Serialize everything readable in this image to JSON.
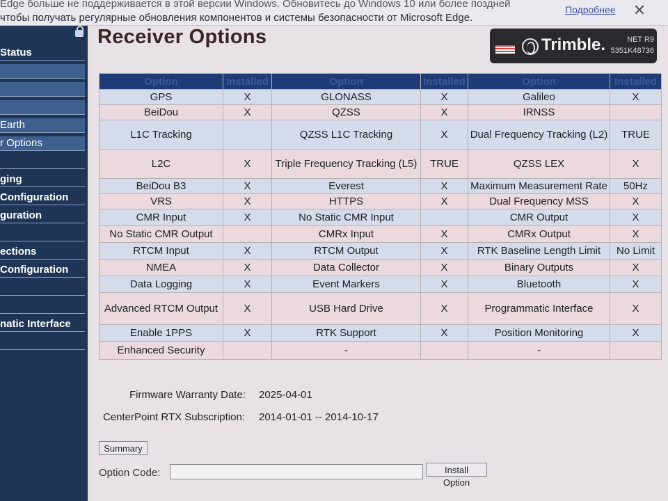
{
  "notification": {
    "line1": "Edge больше не поддерживается в этой версии Windows. Обновитесь до Windows 10 или более поздней",
    "line2": "чтобы получать регулярные обновления компонентов и системы безопасности от Microsoft Edge.",
    "link": "Подробнее",
    "close": "✕"
  },
  "sidebar": {
    "items": [
      {
        "label": "Status",
        "style": "dark"
      },
      {
        "label": "",
        "style": "light"
      },
      {
        "label": "",
        "style": "light"
      },
      {
        "label": "",
        "style": "light"
      },
      {
        "label": "Earth",
        "style": "light"
      },
      {
        "label": "r Options",
        "style": "light"
      },
      {
        "label": "",
        "style": "dark"
      },
      {
        "label": "ging",
        "style": "dark"
      },
      {
        "label": " Configuration",
        "style": "dark"
      },
      {
        "label": "guration",
        "style": "dark"
      },
      {
        "label": "",
        "style": "dark"
      },
      {
        "label": "ections",
        "style": "dark"
      },
      {
        "label": "Configuration",
        "style": "dark"
      },
      {
        "label": "",
        "style": "dark"
      },
      {
        "label": "",
        "style": "dark"
      },
      {
        "label": "natic Interface",
        "style": "dark"
      },
      {
        "label": "",
        "style": "dark"
      }
    ]
  },
  "header": {
    "title": "Receiver Options",
    "brand_name": "Trimble.",
    "model": "NET R9",
    "serial": "5351K48736"
  },
  "options_table": {
    "headers": [
      "Option",
      "Installed",
      "Option",
      "Installed",
      "Option",
      "Installed"
    ],
    "rows": [
      [
        "GPS",
        "X",
        "GLONASS",
        "X",
        "Galileo",
        "X"
      ],
      [
        "BeiDou",
        "X",
        "QZSS",
        "X",
        "IRNSS",
        ""
      ],
      [
        "L1C Tracking",
        "",
        "QZSS L1C Tracking",
        "X",
        "Dual Frequency Tracking (L2)",
        "TRUE"
      ],
      [
        "L2C",
        "X",
        "Triple Frequency Tracking (L5)",
        "TRUE",
        "QZSS LEX",
        "X"
      ],
      [
        "BeiDou B3",
        "X",
        "Everest",
        "X",
        "Maximum Measurement Rate",
        "50Hz"
      ],
      [
        "VRS",
        "X",
        "HTTPS",
        "X",
        "Dual Frequency MSS",
        "X"
      ],
      [
        "CMR Input",
        "X",
        "No Static CMR Input",
        "",
        "CMR Output",
        "X"
      ],
      [
        "No Static CMR Output",
        "",
        "CMRx Input",
        "X",
        "CMRx Output",
        "X"
      ],
      [
        "RTCM Input",
        "X",
        "RTCM Output",
        "X",
        "RTK Baseline Length Limit",
        "No Limit"
      ],
      [
        "NMEA",
        "X",
        "Data Collector",
        "X",
        "Binary Outputs",
        "X"
      ],
      [
        "Data Logging",
        "X",
        "Event Markers",
        "X",
        "Bluetooth",
        "X"
      ],
      [
        "Advanced RTCM Output",
        "X",
        "USB Hard Drive",
        "X",
        "Programmatic Interface",
        "X"
      ],
      [
        "Enable 1PPS",
        "X",
        "RTK Support",
        "X",
        "Position Monitoring",
        "X"
      ],
      [
        "Enhanced Security",
        "",
        "-",
        "",
        "-",
        ""
      ]
    ]
  },
  "info": {
    "warranty_label": "Firmware Warranty Date:",
    "warranty_value": "2025-04-01",
    "rtx_label": "CenterPoint RTX Subscription:",
    "rtx_value": "2014-01-01 -- 2014-10-17"
  },
  "controls": {
    "summary_button": "Summary",
    "option_code_label": "Option Code:",
    "option_code_value": "",
    "install_button": "Install Option"
  }
}
